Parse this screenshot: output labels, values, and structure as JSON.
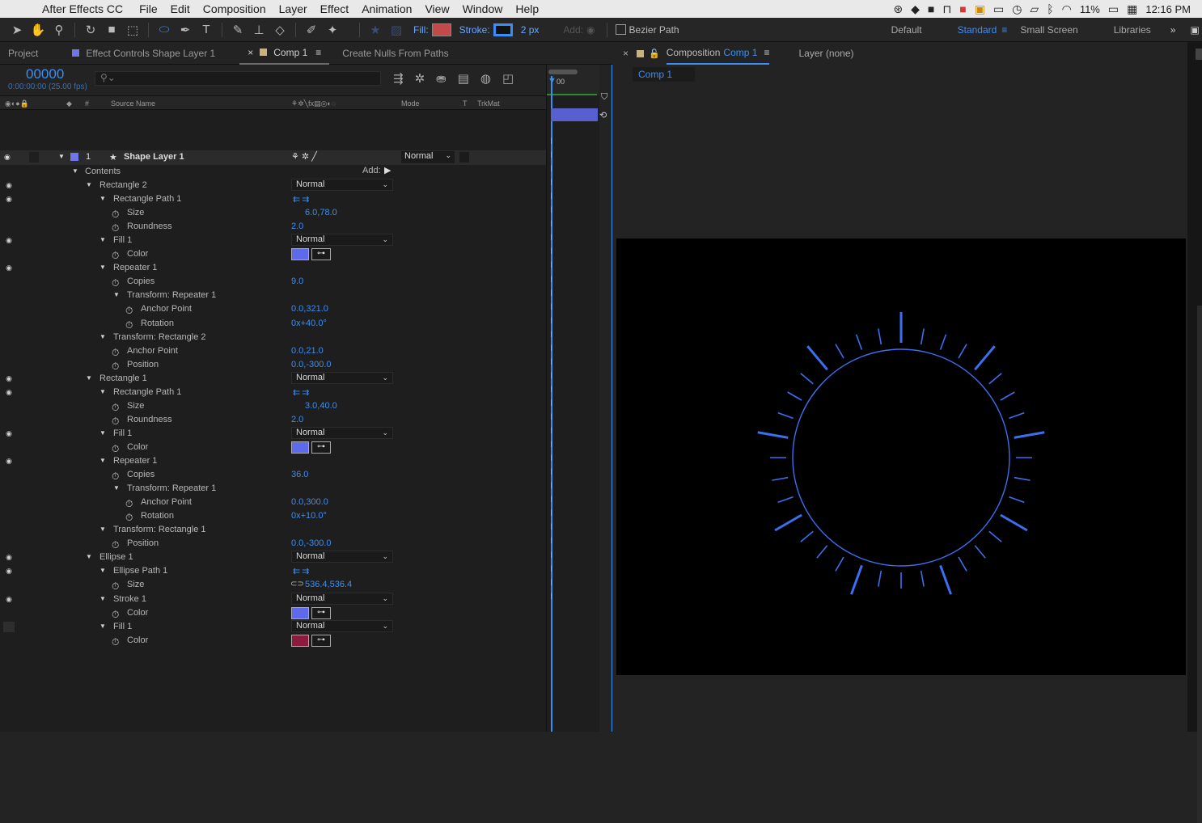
{
  "menubar": {
    "app_name": "After Effects CC",
    "items": [
      "File",
      "Edit",
      "Composition",
      "Layer",
      "Effect",
      "Animation",
      "View",
      "Window",
      "Help"
    ],
    "battery": "11%",
    "clock": "12:16 PM"
  },
  "toolbar": {
    "fill_label": "Fill:",
    "stroke_label": "Stroke:",
    "stroke_width": "2 px",
    "add_label": "Add:",
    "bezier_label": "Bezier Path",
    "fill_color": "#c24a4a",
    "stroke_color": "#3b8ef5",
    "workspaces": [
      "Default",
      "Standard",
      "Small Screen",
      "Libraries"
    ],
    "active_workspace": "Standard"
  },
  "left_panel": {
    "tabs": [
      "Project",
      "Effect Controls Shape Layer 1",
      "Comp 1",
      "Create Nulls From Paths"
    ],
    "timecode": "00000",
    "timecode_sub": "0:00:00:00 (25.00 fps)",
    "search_placeholder": "",
    "columns": {
      "num": "#",
      "source": "Source Name",
      "mode": "Mode",
      "t": "T",
      "trkmat": "TrkMat"
    },
    "layer": {
      "index": "1",
      "name": "Shape Layer 1",
      "mode": "Normal",
      "color": "#6f76e8"
    },
    "contents_label": "Contents",
    "add_label": "Add:"
  },
  "properties": [
    {
      "label": "Rectangle 2",
      "indent": 1,
      "tri": true,
      "eye": true,
      "drop": "Normal"
    },
    {
      "label": "Rectangle Path 1",
      "indent": 2,
      "tri": true,
      "eye": true,
      "arrows": true
    },
    {
      "label": "Size",
      "indent": 3,
      "sw": true,
      "val": "6.0,78.0",
      "link": true,
      "lnkglyph": ""
    },
    {
      "label": "Roundness",
      "indent": 3,
      "sw": true,
      "val": "2.0"
    },
    {
      "label": "Fill 1",
      "indent": 2,
      "tri": true,
      "eye": true,
      "drop": "Normal"
    },
    {
      "label": "Color",
      "indent": 3,
      "sw": true,
      "color": "#5d6bea"
    },
    {
      "label": "Repeater 1",
      "indent": 2,
      "tri": true,
      "eye": true
    },
    {
      "label": "Copies",
      "indent": 3,
      "sw": true,
      "val": "9.0"
    },
    {
      "label": "Transform: Repeater 1",
      "indent": 3,
      "tri": true
    },
    {
      "label": "Anchor Point",
      "indent": 4,
      "sw": true,
      "val": "0.0,321.0"
    },
    {
      "label": "Rotation",
      "indent": 4,
      "sw": true,
      "val": "0x+40.0°"
    },
    {
      "label": "Transform: Rectangle 2",
      "indent": 2,
      "tri": true
    },
    {
      "label": "Anchor Point",
      "indent": 3,
      "sw": true,
      "val": "0.0,21.0"
    },
    {
      "label": "Position",
      "indent": 3,
      "sw": true,
      "val": "0.0,-300.0"
    },
    {
      "label": "Rectangle 1",
      "indent": 1,
      "tri": true,
      "eye": true,
      "drop": "Normal"
    },
    {
      "label": "Rectangle Path 1",
      "indent": 2,
      "tri": true,
      "eye": true,
      "arrows": true
    },
    {
      "label": "Size",
      "indent": 3,
      "sw": true,
      "val": "3.0,40.0",
      "link": true,
      "lnkglyph": ""
    },
    {
      "label": "Roundness",
      "indent": 3,
      "sw": true,
      "val": "2.0"
    },
    {
      "label": "Fill 1",
      "indent": 2,
      "tri": true,
      "eye": true,
      "drop": "Normal"
    },
    {
      "label": "Color",
      "indent": 3,
      "sw": true,
      "color": "#5d6bea"
    },
    {
      "label": "Repeater 1",
      "indent": 2,
      "tri": true,
      "eye": true
    },
    {
      "label": "Copies",
      "indent": 3,
      "sw": true,
      "val": "36.0"
    },
    {
      "label": "Transform: Repeater 1",
      "indent": 3,
      "tri": true
    },
    {
      "label": "Anchor Point",
      "indent": 4,
      "sw": true,
      "val": "0.0,300.0"
    },
    {
      "label": "Rotation",
      "indent": 4,
      "sw": true,
      "val": "0x+10.0°"
    },
    {
      "label": "Transform: Rectangle 1",
      "indent": 2,
      "tri": true
    },
    {
      "label": "Position",
      "indent": 3,
      "sw": true,
      "val": "0.0,-300.0"
    },
    {
      "label": "Ellipse 1",
      "indent": 1,
      "tri": true,
      "eye": true,
      "drop": "Normal"
    },
    {
      "label": "Ellipse Path 1",
      "indent": 2,
      "tri": true,
      "eye": true,
      "arrows": true
    },
    {
      "label": "Size",
      "indent": 3,
      "sw": true,
      "val": "536.4,536.4",
      "link": true,
      "lnkglyph": "⊂⊃"
    },
    {
      "label": "Stroke 1",
      "indent": 2,
      "tri": true,
      "eye": true,
      "drop": "Normal"
    },
    {
      "label": "Color",
      "indent": 3,
      "sw": true,
      "color": "#5d6bea"
    },
    {
      "label": "Fill 1",
      "indent": 2,
      "tri": true,
      "blk": true,
      "drop": "Normal"
    },
    {
      "label": "Color",
      "indent": 3,
      "sw": true,
      "color": "#8c1c3d"
    }
  ],
  "timeline": {
    "ruler_label": "00"
  },
  "right_panel": {
    "tabs": [
      "Composition",
      "Comp 1",
      "Layer (none)"
    ],
    "breadcrumb": "Comp 1"
  },
  "comp": {
    "accent": "#3b6ff0",
    "long_ticks": 9,
    "short_ticks": 36
  }
}
